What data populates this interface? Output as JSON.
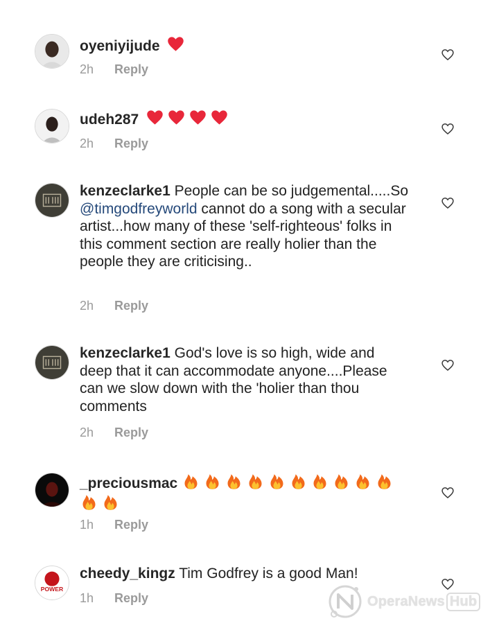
{
  "comments": [
    {
      "username": "oyeniyijude",
      "text": "",
      "emoji": "heart",
      "emoji_count": 1,
      "time": "2h",
      "reply_label": "Reply"
    },
    {
      "username": "udeh287",
      "text": "",
      "emoji": "heart",
      "emoji_count": 4,
      "time": "2h",
      "reply_label": "Reply"
    },
    {
      "username": "kenzeclarke1",
      "text_before": "People can be so judgemental.....So ",
      "mention": "@timgodfreyworld",
      "text_after": " cannot do a song with a secular artist...how many  of these 'self-righteous' folks in this comment section are really holier than the people they are criticising..",
      "time": "2h",
      "reply_label": "Reply"
    },
    {
      "username": "kenzeclarke1",
      "text": "God's love is so high, wide and deep that it can accommodate anyone....Please can we slow down with the 'holier than thou comments",
      "time": "2h",
      "reply_label": "Reply"
    },
    {
      "username": "_preciousmac",
      "text": "",
      "emoji": "fire",
      "emoji_count": 12,
      "time": "1h",
      "reply_label": "Reply"
    },
    {
      "username": "cheedy_kingz",
      "text": "Tim Godfrey is a good Man!",
      "time": "1h",
      "reply_label": "Reply",
      "avatar_text": "POWER"
    }
  ],
  "watermark": {
    "brand": "OperaNews",
    "suffix": "Hub"
  },
  "colors": {
    "heart": "#e8273a",
    "mention": "#25497a",
    "meta": "#9a9a9a"
  }
}
